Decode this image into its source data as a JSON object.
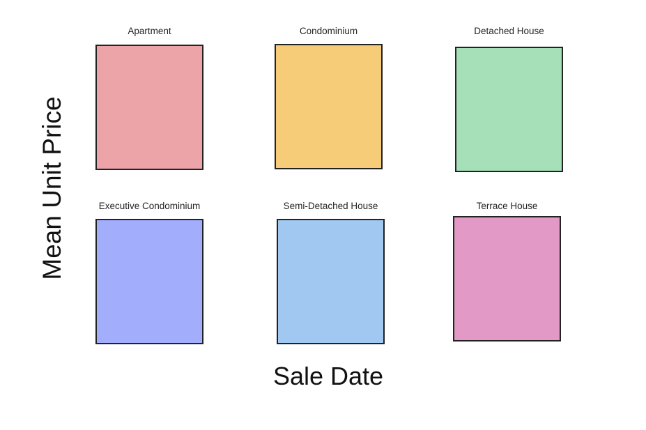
{
  "chart_data": {
    "type": "area",
    "xlabel": "Sale Date",
    "ylabel": "Mean Unit Price",
    "facets": [
      {
        "title": "Apartment",
        "color": "#eca4a8"
      },
      {
        "title": "Condominium",
        "color": "#f7cc78"
      },
      {
        "title": "Detached House",
        "color": "#a6e0b8"
      },
      {
        "title": "Executive Condominium",
        "color": "#a2adfb"
      },
      {
        "title": "Semi-Detached House",
        "color": "#a0c8f0"
      },
      {
        "title": "Terrace House",
        "color": "#e299c6"
      }
    ]
  }
}
